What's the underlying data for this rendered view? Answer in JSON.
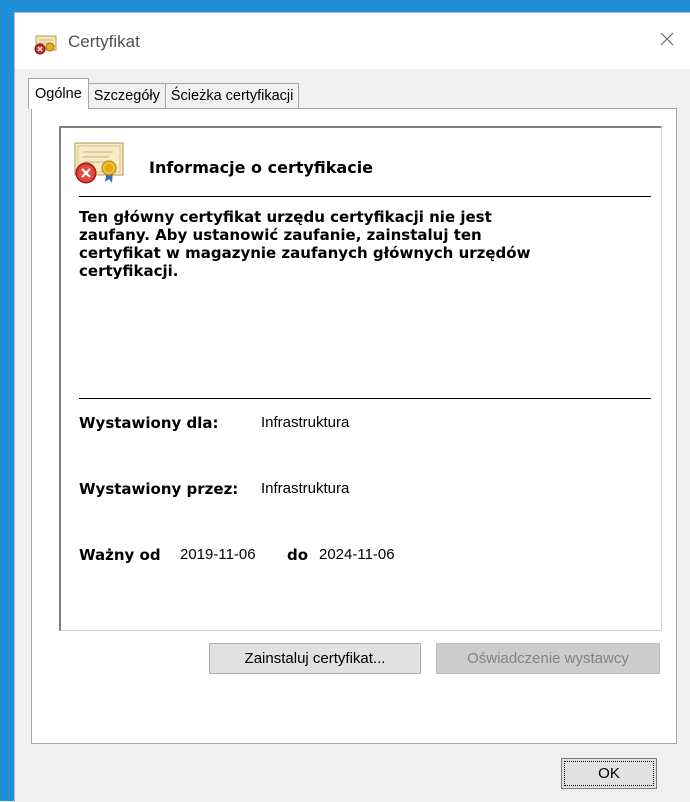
{
  "window": {
    "title": "Certyfikat",
    "close_glyph": "✕",
    "title_icon": "certificate-error-icon",
    "accent_color": "#1e8fd6"
  },
  "tabs": [
    {
      "label": "Ogólne",
      "active": true
    },
    {
      "label": "Szczegóły",
      "active": false
    },
    {
      "label": "Ścieżka certyfikacji",
      "active": false
    }
  ],
  "info": {
    "icon": "certificate-error-icon",
    "heading": "Informacje o certyfikacie",
    "purpose_lines": [
      "Ten główny certyfikat urzędu certyfikacji nie jest",
      "zaufany. Aby ustanowić zaufanie, zainstaluj ten",
      "certyfikat w magazynie zaufanych głównych urzędów",
      "certyfikacji."
    ],
    "issued_to_label": "Wystawiony dla:",
    "issued_to_value": "Infrastruktura",
    "issued_by_label": "Wystawiony przez:",
    "issued_by_value": "Infrastruktura",
    "valid_from_label": "Ważny od",
    "valid_from_value": "2019-11-06",
    "valid_to_label": "do",
    "valid_to_value": "2024-11-06"
  },
  "buttons": {
    "install": "Zainstaluj certyfikat...",
    "issuer_statement": "Oświadczenie wystawcy",
    "ok": "OK"
  }
}
